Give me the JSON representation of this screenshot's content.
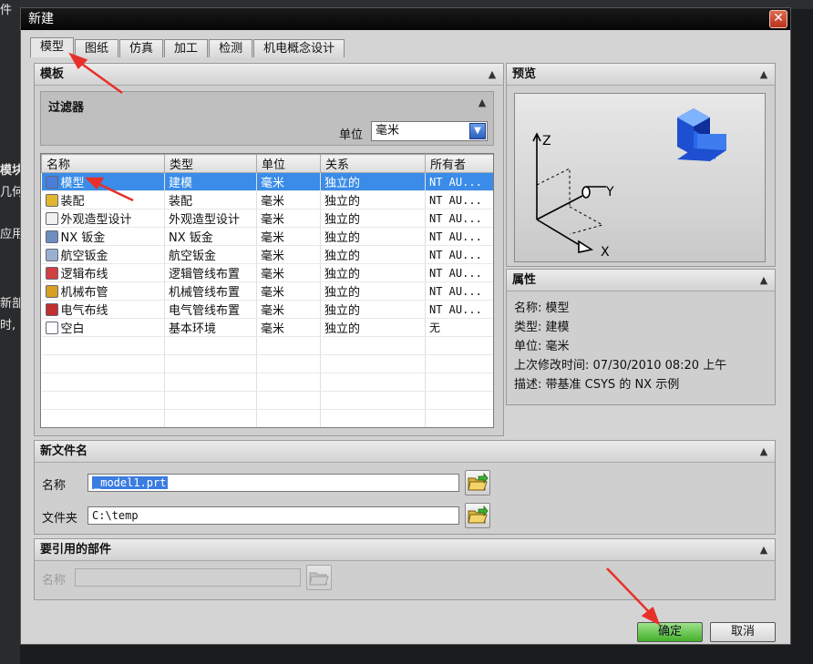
{
  "background": {
    "left_fragments": [
      "件",
      "模块",
      "几何",
      "应用",
      "新部",
      "时,"
    ]
  },
  "dialog": {
    "title": "新建",
    "close_glyph": "✕",
    "tabs": [
      {
        "label": "模型",
        "active": true
      },
      {
        "label": "图纸",
        "active": false
      },
      {
        "label": "仿真",
        "active": false
      },
      {
        "label": "加工",
        "active": false
      },
      {
        "label": "检测",
        "active": false
      },
      {
        "label": "机电概念设计",
        "active": false
      }
    ]
  },
  "templates": {
    "header": "模板",
    "filter": {
      "title": "过滤器",
      "unit_label": "单位",
      "unit_value": "毫米"
    },
    "columns": [
      "名称",
      "类型",
      "单位",
      "关系",
      "所有者"
    ],
    "rows": [
      {
        "name": "模型",
        "type": "建模",
        "unit": "毫米",
        "relation": "独立的",
        "owner": "NT AU...",
        "icon": "model-icon",
        "icon_color": "#4a7ed8",
        "selected": true
      },
      {
        "name": "装配",
        "type": "装配",
        "unit": "毫米",
        "relation": "独立的",
        "owner": "NT AU...",
        "icon": "assembly-icon",
        "icon_color": "#e0b830"
      },
      {
        "name": "外观造型设计",
        "type": "外观造型设计",
        "unit": "毫米",
        "relation": "独立的",
        "owner": "NT AU...",
        "icon": "shape-studio-icon",
        "icon_color": "#f0f0f0"
      },
      {
        "name": "NX 钣金",
        "type": "NX 钣金",
        "unit": "毫米",
        "relation": "独立的",
        "owner": "NT AU...",
        "icon": "sheet-metal-icon",
        "icon_color": "#6c8fc0"
      },
      {
        "name": "航空钣金",
        "type": "航空钣金",
        "unit": "毫米",
        "relation": "独立的",
        "owner": "NT AU...",
        "icon": "aero-sheet-metal-icon",
        "icon_color": "#9ab0d0"
      },
      {
        "name": "逻辑布线",
        "type": "逻辑管线布置",
        "unit": "毫米",
        "relation": "独立的",
        "owner": "NT AU...",
        "icon": "logical-routing-icon",
        "icon_color": "#d04040"
      },
      {
        "name": "机械布管",
        "type": "机械管线布置",
        "unit": "毫米",
        "relation": "独立的",
        "owner": "NT AU...",
        "icon": "mech-routing-icon",
        "icon_color": "#d8a020"
      },
      {
        "name": "电气布线",
        "type": "电气管线布置",
        "unit": "毫米",
        "relation": "独立的",
        "owner": "NT AU...",
        "icon": "elec-routing-icon",
        "icon_color": "#c03030"
      },
      {
        "name": "空白",
        "type": "基本环境",
        "unit": "毫米",
        "relation": "独立的",
        "owner": "无",
        "icon": "blank-icon",
        "icon_color": "#ffffff"
      }
    ],
    "empty_rows": 6
  },
  "preview": {
    "header": "预览",
    "axes": {
      "z": "Z",
      "y": "Y",
      "x": "X"
    }
  },
  "properties": {
    "header": "属性",
    "items": [
      {
        "label": "名称:",
        "value": "模型"
      },
      {
        "label": "类型:",
        "value": "建模"
      },
      {
        "label": "单位:",
        "value": "毫米"
      },
      {
        "label": "上次修改时间:",
        "value": "07/30/2010 08:20 上午"
      },
      {
        "label": "描述:",
        "value": "带基准 CSYS 的 NX 示例"
      }
    ]
  },
  "new_file": {
    "header": "新文件名",
    "name_label": "名称",
    "name_value": "_model1.prt",
    "folder_label": "文件夹",
    "folder_value": "C:\\temp"
  },
  "referenced_part": {
    "header": "要引用的部件",
    "name_label": "名称",
    "name_value": ""
  },
  "buttons": {
    "ok": "确定",
    "cancel": "取消"
  },
  "annotation_color": "#e8302a"
}
